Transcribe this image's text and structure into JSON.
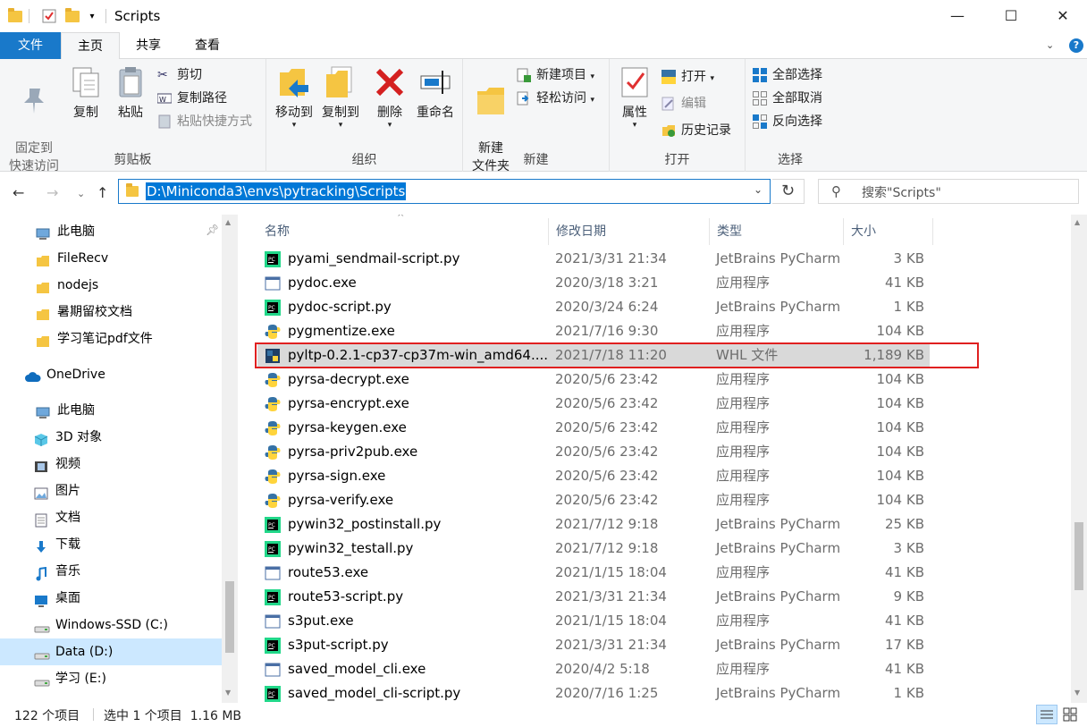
{
  "window": {
    "title": "Scripts",
    "minimize": "—",
    "maximize": "☐",
    "close": "✕"
  },
  "tabs": [
    {
      "label": "文件"
    },
    {
      "label": "主页"
    },
    {
      "label": "共享"
    },
    {
      "label": "查看"
    }
  ],
  "ribbon": {
    "clipboard": {
      "title": "剪贴板",
      "pin": "固定到\n快速访问",
      "copy": "复制",
      "paste": "粘贴",
      "cut": "剪切",
      "copy_path": "复制路径",
      "paste_shortcut": "粘贴快捷方式"
    },
    "organize": {
      "title": "组织",
      "move_to": "移动到",
      "copy_to": "复制到",
      "delete": "删除",
      "rename": "重命名"
    },
    "new": {
      "title": "新建",
      "new_folder": "新建\n文件夹",
      "new_item": "新建项目",
      "easy_access": "轻松访问"
    },
    "open": {
      "title": "打开",
      "properties": "属性",
      "open": "打开",
      "edit": "编辑",
      "history": "历史记录"
    },
    "select": {
      "title": "选择",
      "select_all": "全部选择",
      "select_none": "全部取消",
      "invert": "反向选择"
    }
  },
  "address": {
    "path": "D:\\Miniconda3\\envs\\pytracking\\Scripts",
    "search_placeholder": "搜索\"Scripts\""
  },
  "nav": [
    {
      "label": "此电脑",
      "icon": "computer-icon",
      "indent": 0
    },
    {
      "label": "FileRecv",
      "icon": "folder-icon",
      "indent": 0
    },
    {
      "label": "nodejs",
      "icon": "folder-icon",
      "indent": 0
    },
    {
      "label": "暑期留校文档",
      "icon": "folder-icon",
      "indent": 0
    },
    {
      "label": "学习笔记pdf文件",
      "icon": "folder-icon",
      "indent": 0
    },
    {
      "label": "OneDrive",
      "icon": "cloud-icon",
      "indent": 0
    },
    {
      "label": "此电脑",
      "icon": "computer-icon",
      "indent": 0
    },
    {
      "label": "3D 对象",
      "icon": "cube-icon",
      "indent": 1
    },
    {
      "label": "视频",
      "icon": "video-icon",
      "indent": 1
    },
    {
      "label": "图片",
      "icon": "picture-icon",
      "indent": 1
    },
    {
      "label": "文档",
      "icon": "document-icon",
      "indent": 1
    },
    {
      "label": "下载",
      "icon": "download-icon",
      "indent": 1
    },
    {
      "label": "音乐",
      "icon": "music-icon",
      "indent": 1
    },
    {
      "label": "桌面",
      "icon": "desktop-icon",
      "indent": 1
    },
    {
      "label": "Windows-SSD (C:)",
      "icon": "drive-icon",
      "indent": 1
    },
    {
      "label": "Data (D:)",
      "icon": "drive-icon",
      "indent": 1,
      "selected": true
    },
    {
      "label": "学习 (E:)",
      "icon": "drive-icon",
      "indent": 1
    }
  ],
  "columns": {
    "name": "名称",
    "date": "修改日期",
    "type": "类型",
    "size": "大小"
  },
  "files": [
    {
      "name": "pyami_sendmail-script.py",
      "date": "2021/3/31 21:34",
      "type": "JetBrains PyCharm",
      "size": "3 KB",
      "icon": "pycharm-icon"
    },
    {
      "name": "pydoc.exe",
      "date": "2020/3/18 3:21",
      "type": "应用程序",
      "size": "41 KB",
      "icon": "exe-icon"
    },
    {
      "name": "pydoc-script.py",
      "date": "2020/3/24 6:24",
      "type": "JetBrains PyCharm",
      "size": "1 KB",
      "icon": "pycharm-icon"
    },
    {
      "name": "pygmentize.exe",
      "date": "2021/7/16 9:30",
      "type": "应用程序",
      "size": "104 KB",
      "icon": "python-exe-icon"
    },
    {
      "name": "pyltp-0.2.1-cp37-cp37m-win_amd64....",
      "date": "2021/7/18 11:20",
      "type": "WHL 文件",
      "size": "1,189 KB",
      "icon": "whl-icon",
      "selected": true
    },
    {
      "name": "pyrsa-decrypt.exe",
      "date": "2020/5/6 23:42",
      "type": "应用程序",
      "size": "104 KB",
      "icon": "python-exe-icon"
    },
    {
      "name": "pyrsa-encrypt.exe",
      "date": "2020/5/6 23:42",
      "type": "应用程序",
      "size": "104 KB",
      "icon": "python-exe-icon"
    },
    {
      "name": "pyrsa-keygen.exe",
      "date": "2020/5/6 23:42",
      "type": "应用程序",
      "size": "104 KB",
      "icon": "python-exe-icon"
    },
    {
      "name": "pyrsa-priv2pub.exe",
      "date": "2020/5/6 23:42",
      "type": "应用程序",
      "size": "104 KB",
      "icon": "python-exe-icon"
    },
    {
      "name": "pyrsa-sign.exe",
      "date": "2020/5/6 23:42",
      "type": "应用程序",
      "size": "104 KB",
      "icon": "python-exe-icon"
    },
    {
      "name": "pyrsa-verify.exe",
      "date": "2020/5/6 23:42",
      "type": "应用程序",
      "size": "104 KB",
      "icon": "python-exe-icon"
    },
    {
      "name": "pywin32_postinstall.py",
      "date": "2021/7/12 9:18",
      "type": "JetBrains PyCharm",
      "size": "25 KB",
      "icon": "pycharm-icon"
    },
    {
      "name": "pywin32_testall.py",
      "date": "2021/7/12 9:18",
      "type": "JetBrains PyCharm",
      "size": "3 KB",
      "icon": "pycharm-icon"
    },
    {
      "name": "route53.exe",
      "date": "2021/1/15 18:04",
      "type": "应用程序",
      "size": "41 KB",
      "icon": "exe-icon"
    },
    {
      "name": "route53-script.py",
      "date": "2021/3/31 21:34",
      "type": "JetBrains PyCharm",
      "size": "9 KB",
      "icon": "pycharm-icon"
    },
    {
      "name": "s3put.exe",
      "date": "2021/1/15 18:04",
      "type": "应用程序",
      "size": "41 KB",
      "icon": "exe-icon"
    },
    {
      "name": "s3put-script.py",
      "date": "2021/3/31 21:34",
      "type": "JetBrains PyCharm",
      "size": "17 KB",
      "icon": "pycharm-icon"
    },
    {
      "name": "saved_model_cli.exe",
      "date": "2020/4/2 5:18",
      "type": "应用程序",
      "size": "41 KB",
      "icon": "exe-icon"
    },
    {
      "name": "saved_model_cli-script.py",
      "date": "2020/7/16 1:25",
      "type": "JetBrains PyCharm",
      "size": "1 KB",
      "icon": "pycharm-icon"
    }
  ],
  "status": {
    "count": "122 个项目",
    "selection": "选中 1 个项目  1.16 MB"
  },
  "colors": {
    "accent": "#1979ca",
    "selection": "#cce8ff",
    "highlight_box": "#e02020"
  }
}
